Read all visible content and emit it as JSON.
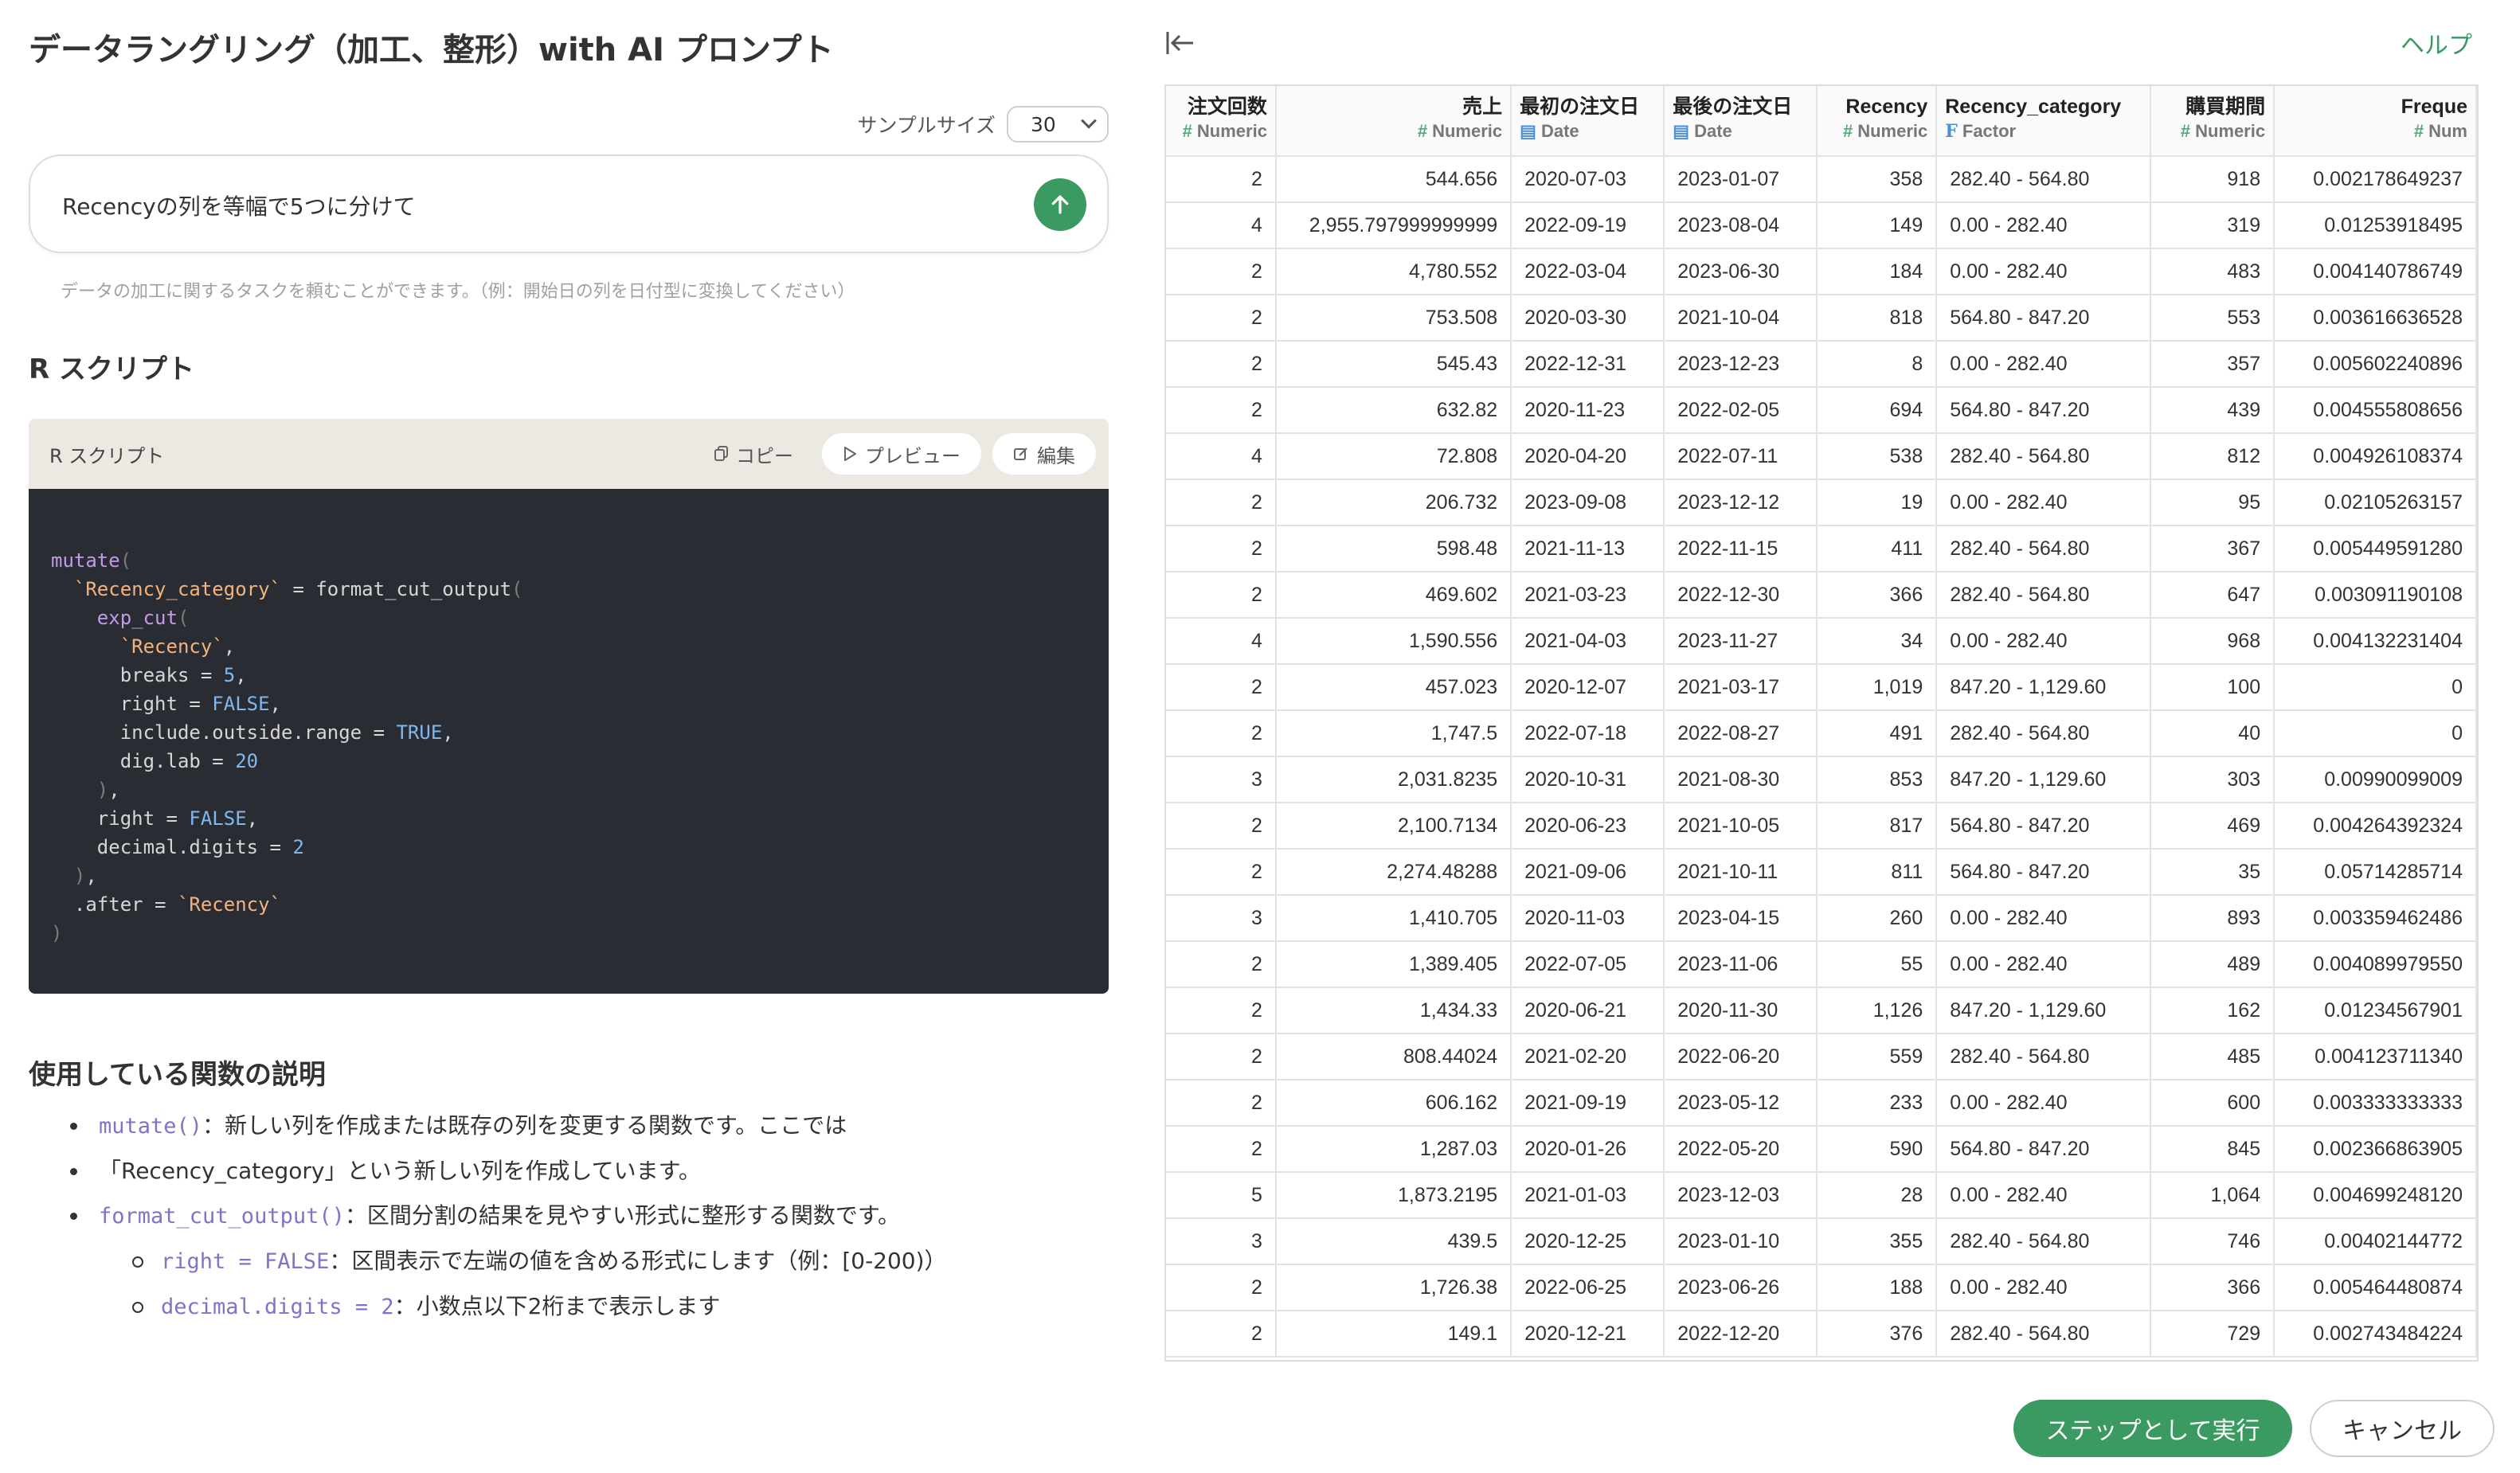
{
  "dialog": {
    "title": "データラングリング（加工、整形）with AI プロンプト",
    "help_label": "ヘルプ",
    "run_label": "ステップとして実行",
    "cancel_label": "キャンセル"
  },
  "prompt": {
    "sample_size_label": "サンプルサイズ",
    "sample_size_value": "30",
    "input_value": "Recencyの列を等幅で5つに分けて",
    "hint": "データの加工に関するタスクを頼むことができます。（例：開始日の列を日付型に変換してください）"
  },
  "script": {
    "section_title": "R スクリプト",
    "card_title": "R スクリプト",
    "copy_label": "コピー",
    "preview_label": "プレビュー",
    "edit_label": "編集",
    "lines": [
      "mutate(",
      "  `Recency_category` = format_cut_output(",
      "    exp_cut(",
      "      `Recency`,",
      "      breaks = 5,",
      "      right = FALSE,",
      "      include.outside.range = TRUE,",
      "      dig.lab = 20",
      "    ),",
      "    right = FALSE,",
      "    decimal.digits = 2",
      "  ),",
      "  .after = `Recency`",
      ")"
    ]
  },
  "functions": {
    "section_title": "使用している関数の説明",
    "items": [
      {
        "code": "mutate()",
        "text": "：新しい列を作成または既存の列を変更する関数です。ここでは",
        "text2": "「Recency_category」という新しい列を作成しています。"
      },
      {
        "code": "format_cut_output()",
        "text": "：区間分割の結果を見やすい形式に整形する関数です。",
        "subs": [
          {
            "code": "right = FALSE",
            "text": "：区間表示で左端の値を含める形式にします（例：[0-200)）"
          },
          {
            "code": "decimal.digits = 2",
            "text": "：小数点以下2桁まで表示します"
          }
        ]
      }
    ]
  },
  "table": {
    "columns": [
      {
        "name": "注文回数",
        "type": "Numeric",
        "kind": "num"
      },
      {
        "name": "売上",
        "type": "Numeric",
        "kind": "num"
      },
      {
        "name": "最初の注文日",
        "type": "Date",
        "kind": "date"
      },
      {
        "name": "最後の注文日",
        "type": "Date",
        "kind": "date"
      },
      {
        "name": "Recency",
        "type": "Numeric",
        "kind": "num"
      },
      {
        "name": "Recency_category",
        "type": "Factor",
        "kind": "fac"
      },
      {
        "name": "購買期間",
        "type": "Numeric",
        "kind": "num"
      },
      {
        "name": "Freque",
        "type": "Num",
        "kind": "num"
      }
    ],
    "rows": [
      [
        "2",
        "544.656",
        "2020-07-03",
        "2023-01-07",
        "358",
        "282.40 - 564.80",
        "918",
        "0.002178649237"
      ],
      [
        "4",
        "2,955.797999999999",
        "2022-09-19",
        "2023-08-04",
        "149",
        "0.00 - 282.40",
        "319",
        "0.01253918495"
      ],
      [
        "2",
        "4,780.552",
        "2022-03-04",
        "2023-06-30",
        "184",
        "0.00 - 282.40",
        "483",
        "0.004140786749"
      ],
      [
        "2",
        "753.508",
        "2020-03-30",
        "2021-10-04",
        "818",
        "564.80 - 847.20",
        "553",
        "0.003616636528"
      ],
      [
        "2",
        "545.43",
        "2022-12-31",
        "2023-12-23",
        "8",
        "0.00 - 282.40",
        "357",
        "0.005602240896"
      ],
      [
        "2",
        "632.82",
        "2020-11-23",
        "2022-02-05",
        "694",
        "564.80 - 847.20",
        "439",
        "0.004555808656"
      ],
      [
        "4",
        "72.808",
        "2020-04-20",
        "2022-07-11",
        "538",
        "282.40 - 564.80",
        "812",
        "0.004926108374"
      ],
      [
        "2",
        "206.732",
        "2023-09-08",
        "2023-12-12",
        "19",
        "0.00 - 282.40",
        "95",
        "0.02105263157"
      ],
      [
        "2",
        "598.48",
        "2021-11-13",
        "2022-11-15",
        "411",
        "282.40 - 564.80",
        "367",
        "0.005449591280"
      ],
      [
        "2",
        "469.602",
        "2021-03-23",
        "2022-12-30",
        "366",
        "282.40 - 564.80",
        "647",
        "0.003091190108"
      ],
      [
        "4",
        "1,590.556",
        "2021-04-03",
        "2023-11-27",
        "34",
        "0.00 - 282.40",
        "968",
        "0.004132231404"
      ],
      [
        "2",
        "457.023",
        "2020-12-07",
        "2021-03-17",
        "1,019",
        "847.20 - 1,129.60",
        "100",
        "0"
      ],
      [
        "2",
        "1,747.5",
        "2022-07-18",
        "2022-08-27",
        "491",
        "282.40 - 564.80",
        "40",
        "0"
      ],
      [
        "3",
        "2,031.8235",
        "2020-10-31",
        "2021-08-30",
        "853",
        "847.20 - 1,129.60",
        "303",
        "0.00990099009"
      ],
      [
        "2",
        "2,100.7134",
        "2020-06-23",
        "2021-10-05",
        "817",
        "564.80 - 847.20",
        "469",
        "0.004264392324"
      ],
      [
        "2",
        "2,274.48288",
        "2021-09-06",
        "2021-10-11",
        "811",
        "564.80 - 847.20",
        "35",
        "0.05714285714"
      ],
      [
        "3",
        "1,410.705",
        "2020-11-03",
        "2023-04-15",
        "260",
        "0.00 - 282.40",
        "893",
        "0.003359462486"
      ],
      [
        "2",
        "1,389.405",
        "2022-07-05",
        "2023-11-06",
        "55",
        "0.00 - 282.40",
        "489",
        "0.004089979550"
      ],
      [
        "2",
        "1,434.33",
        "2020-06-21",
        "2020-11-30",
        "1,126",
        "847.20 - 1,129.60",
        "162",
        "0.01234567901"
      ],
      [
        "2",
        "808.44024",
        "2021-02-20",
        "2022-06-20",
        "559",
        "282.40 - 564.80",
        "485",
        "0.004123711340"
      ],
      [
        "2",
        "606.162",
        "2021-09-19",
        "2023-05-12",
        "233",
        "0.00 - 282.40",
        "600",
        "0.003333333333"
      ],
      [
        "2",
        "1,287.03",
        "2020-01-26",
        "2022-05-20",
        "590",
        "564.80 - 847.20",
        "845",
        "0.002366863905"
      ],
      [
        "5",
        "1,873.2195",
        "2021-01-03",
        "2023-12-03",
        "28",
        "0.00 - 282.40",
        "1,064",
        "0.004699248120"
      ],
      [
        "3",
        "439.5",
        "2020-12-25",
        "2023-01-10",
        "355",
        "282.40 - 564.80",
        "746",
        "0.00402144772"
      ],
      [
        "2",
        "1,726.38",
        "2022-06-25",
        "2023-06-26",
        "188",
        "0.00 - 282.40",
        "366",
        "0.005464480874"
      ],
      [
        "2",
        "149.1",
        "2020-12-21",
        "2022-12-20",
        "376",
        "282.40 - 564.80",
        "729",
        "0.002743484224"
      ]
    ]
  },
  "colors": {
    "accent_green": "#3a9a62",
    "code_bg": "#2a2c33",
    "code_header_bg": "#ebe9e1"
  }
}
